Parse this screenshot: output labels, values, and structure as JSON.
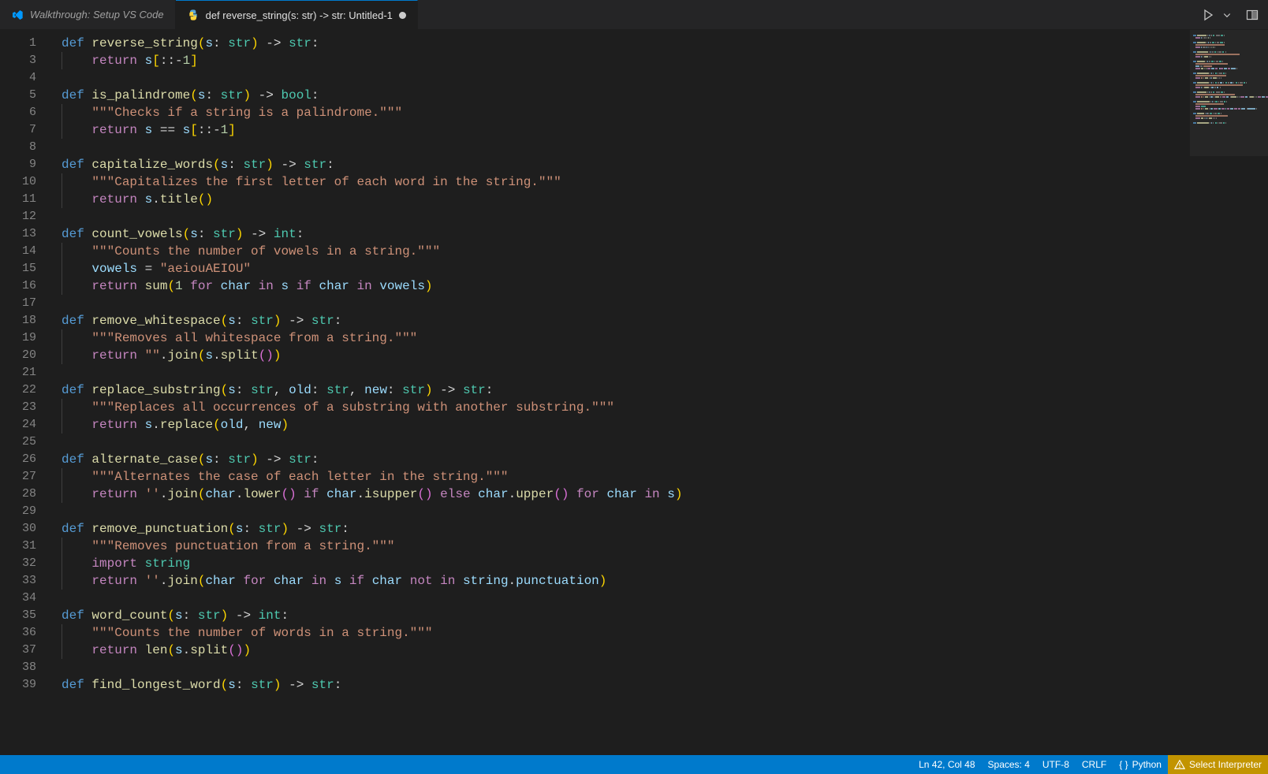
{
  "tabs": [
    {
      "icon": "vscode",
      "label": "Walkthrough: Setup VS Code",
      "active": false,
      "dirty": false
    },
    {
      "icon": "python",
      "label": "def reverse_string(s: str) -> str: Untitled-1",
      "active": true,
      "dirty": true
    }
  ],
  "actions": {
    "run": "run",
    "chevron": "chevron-down",
    "split": "split-horizontal",
    "more": "more"
  },
  "line_numbers": [
    1,
    3,
    4,
    5,
    6,
    7,
    8,
    9,
    10,
    11,
    12,
    13,
    14,
    15,
    16,
    17,
    18,
    19,
    20,
    21,
    22,
    23,
    24,
    25,
    26,
    27,
    28,
    29,
    30,
    31,
    32,
    33,
    34,
    35,
    36,
    37,
    38,
    39
  ],
  "code": [
    [
      {
        "t": "def ",
        "c": "kw"
      },
      {
        "t": "reverse_string",
        "c": "fn"
      },
      {
        "t": "(",
        "c": "brk1"
      },
      {
        "t": "s",
        "c": "prm"
      },
      {
        "t": ": ",
        "c": "pun"
      },
      {
        "t": "str",
        "c": "cls"
      },
      {
        "t": ")",
        "c": "brk1"
      },
      {
        "t": " -> ",
        "c": "op"
      },
      {
        "t": "str",
        "c": "cls"
      },
      {
        "t": ":",
        "c": "pun"
      }
    ],
    [
      {
        "indent": 1
      },
      {
        "t": "return ",
        "c": "kw2"
      },
      {
        "t": "s",
        "c": "prm"
      },
      {
        "t": "[",
        "c": "brk1"
      },
      {
        "t": "::",
        "c": "pun"
      },
      {
        "t": "-",
        "c": "op"
      },
      {
        "t": "1",
        "c": "num"
      },
      {
        "t": "]",
        "c": "brk1"
      }
    ],
    [],
    [
      {
        "t": "def ",
        "c": "kw"
      },
      {
        "t": "is_palindrome",
        "c": "fn"
      },
      {
        "t": "(",
        "c": "brk1"
      },
      {
        "t": "s",
        "c": "prm"
      },
      {
        "t": ": ",
        "c": "pun"
      },
      {
        "t": "str",
        "c": "cls"
      },
      {
        "t": ")",
        "c": "brk1"
      },
      {
        "t": " -> ",
        "c": "op"
      },
      {
        "t": "bool",
        "c": "cls"
      },
      {
        "t": ":",
        "c": "pun"
      }
    ],
    [
      {
        "indent": 1
      },
      {
        "t": "\"\"\"Checks if a string is a palindrome.\"\"\"",
        "c": "str"
      }
    ],
    [
      {
        "indent": 1
      },
      {
        "t": "return ",
        "c": "kw2"
      },
      {
        "t": "s",
        "c": "prm"
      },
      {
        "t": " == ",
        "c": "op"
      },
      {
        "t": "s",
        "c": "prm"
      },
      {
        "t": "[",
        "c": "brk1"
      },
      {
        "t": "::",
        "c": "pun"
      },
      {
        "t": "-",
        "c": "op"
      },
      {
        "t": "1",
        "c": "num"
      },
      {
        "t": "]",
        "c": "brk1"
      }
    ],
    [],
    [
      {
        "t": "def ",
        "c": "kw"
      },
      {
        "t": "capitalize_words",
        "c": "fn"
      },
      {
        "t": "(",
        "c": "brk1"
      },
      {
        "t": "s",
        "c": "prm"
      },
      {
        "t": ": ",
        "c": "pun"
      },
      {
        "t": "str",
        "c": "cls"
      },
      {
        "t": ")",
        "c": "brk1"
      },
      {
        "t": " -> ",
        "c": "op"
      },
      {
        "t": "str",
        "c": "cls"
      },
      {
        "t": ":",
        "c": "pun"
      }
    ],
    [
      {
        "indent": 1
      },
      {
        "t": "\"\"\"Capitalizes the first letter of each word in the string.\"\"\"",
        "c": "str"
      }
    ],
    [
      {
        "indent": 1
      },
      {
        "t": "return ",
        "c": "kw2"
      },
      {
        "t": "s",
        "c": "prm"
      },
      {
        "t": ".",
        "c": "pun"
      },
      {
        "t": "title",
        "c": "fn"
      },
      {
        "t": "(",
        "c": "brk1"
      },
      {
        "t": ")",
        "c": "brk1"
      }
    ],
    [],
    [
      {
        "t": "def ",
        "c": "kw"
      },
      {
        "t": "count_vowels",
        "c": "fn"
      },
      {
        "t": "(",
        "c": "brk1"
      },
      {
        "t": "s",
        "c": "prm"
      },
      {
        "t": ": ",
        "c": "pun"
      },
      {
        "t": "str",
        "c": "cls"
      },
      {
        "t": ")",
        "c": "brk1"
      },
      {
        "t": " -> ",
        "c": "op"
      },
      {
        "t": "int",
        "c": "cls"
      },
      {
        "t": ":",
        "c": "pun"
      }
    ],
    [
      {
        "indent": 1
      },
      {
        "t": "\"\"\"Counts the number of vowels in a string.\"\"\"",
        "c": "str"
      }
    ],
    [
      {
        "indent": 1
      },
      {
        "t": "vowels",
        "c": "prm"
      },
      {
        "t": " = ",
        "c": "op"
      },
      {
        "t": "\"aeiouAEIOU\"",
        "c": "str"
      }
    ],
    [
      {
        "indent": 1
      },
      {
        "t": "return ",
        "c": "kw2"
      },
      {
        "t": "sum",
        "c": "fn"
      },
      {
        "t": "(",
        "c": "brk1"
      },
      {
        "t": "1",
        "c": "num"
      },
      {
        "t": " for ",
        "c": "kw2"
      },
      {
        "t": "char",
        "c": "prm"
      },
      {
        "t": " in ",
        "c": "kw2"
      },
      {
        "t": "s",
        "c": "prm"
      },
      {
        "t": " if ",
        "c": "kw2"
      },
      {
        "t": "char",
        "c": "prm"
      },
      {
        "t": " in ",
        "c": "kw2"
      },
      {
        "t": "vowels",
        "c": "prm"
      },
      {
        "t": ")",
        "c": "brk1"
      }
    ],
    [],
    [
      {
        "t": "def ",
        "c": "kw"
      },
      {
        "t": "remove_whitespace",
        "c": "fn"
      },
      {
        "t": "(",
        "c": "brk1"
      },
      {
        "t": "s",
        "c": "prm"
      },
      {
        "t": ": ",
        "c": "pun"
      },
      {
        "t": "str",
        "c": "cls"
      },
      {
        "t": ")",
        "c": "brk1"
      },
      {
        "t": " -> ",
        "c": "op"
      },
      {
        "t": "str",
        "c": "cls"
      },
      {
        "t": ":",
        "c": "pun"
      }
    ],
    [
      {
        "indent": 1
      },
      {
        "t": "\"\"\"Removes all whitespace from a string.\"\"\"",
        "c": "str"
      }
    ],
    [
      {
        "indent": 1
      },
      {
        "t": "return ",
        "c": "kw2"
      },
      {
        "t": "\"\"",
        "c": "str"
      },
      {
        "t": ".",
        "c": "pun"
      },
      {
        "t": "join",
        "c": "fn"
      },
      {
        "t": "(",
        "c": "brk1"
      },
      {
        "t": "s",
        "c": "prm"
      },
      {
        "t": ".",
        "c": "pun"
      },
      {
        "t": "split",
        "c": "fn"
      },
      {
        "t": "(",
        "c": "brk2"
      },
      {
        "t": ")",
        "c": "brk2"
      },
      {
        "t": ")",
        "c": "brk1"
      }
    ],
    [],
    [
      {
        "t": "def ",
        "c": "kw"
      },
      {
        "t": "replace_substring",
        "c": "fn"
      },
      {
        "t": "(",
        "c": "brk1"
      },
      {
        "t": "s",
        "c": "prm"
      },
      {
        "t": ": ",
        "c": "pun"
      },
      {
        "t": "str",
        "c": "cls"
      },
      {
        "t": ", ",
        "c": "pun"
      },
      {
        "t": "old",
        "c": "prm"
      },
      {
        "t": ": ",
        "c": "pun"
      },
      {
        "t": "str",
        "c": "cls"
      },
      {
        "t": ", ",
        "c": "pun"
      },
      {
        "t": "new",
        "c": "prm"
      },
      {
        "t": ": ",
        "c": "pun"
      },
      {
        "t": "str",
        "c": "cls"
      },
      {
        "t": ")",
        "c": "brk1"
      },
      {
        "t": " -> ",
        "c": "op"
      },
      {
        "t": "str",
        "c": "cls"
      },
      {
        "t": ":",
        "c": "pun"
      }
    ],
    [
      {
        "indent": 1
      },
      {
        "t": "\"\"\"Replaces all occurrences of a substring with another substring.\"\"\"",
        "c": "str"
      }
    ],
    [
      {
        "indent": 1
      },
      {
        "t": "return ",
        "c": "kw2"
      },
      {
        "t": "s",
        "c": "prm"
      },
      {
        "t": ".",
        "c": "pun"
      },
      {
        "t": "replace",
        "c": "fn"
      },
      {
        "t": "(",
        "c": "brk1"
      },
      {
        "t": "old",
        "c": "prm"
      },
      {
        "t": ", ",
        "c": "pun"
      },
      {
        "t": "new",
        "c": "prm"
      },
      {
        "t": ")",
        "c": "brk1"
      }
    ],
    [],
    [
      {
        "t": "def ",
        "c": "kw"
      },
      {
        "t": "alternate_case",
        "c": "fn"
      },
      {
        "t": "(",
        "c": "brk1"
      },
      {
        "t": "s",
        "c": "prm"
      },
      {
        "t": ": ",
        "c": "pun"
      },
      {
        "t": "str",
        "c": "cls"
      },
      {
        "t": ")",
        "c": "brk1"
      },
      {
        "t": " -> ",
        "c": "op"
      },
      {
        "t": "str",
        "c": "cls"
      },
      {
        "t": ":",
        "c": "pun"
      }
    ],
    [
      {
        "indent": 1
      },
      {
        "t": "\"\"\"Alternates the case of each letter in the string.\"\"\"",
        "c": "str"
      }
    ],
    [
      {
        "indent": 1
      },
      {
        "t": "return ",
        "c": "kw2"
      },
      {
        "t": "''",
        "c": "str"
      },
      {
        "t": ".",
        "c": "pun"
      },
      {
        "t": "join",
        "c": "fn"
      },
      {
        "t": "(",
        "c": "brk1"
      },
      {
        "t": "char",
        "c": "prm"
      },
      {
        "t": ".",
        "c": "pun"
      },
      {
        "t": "lower",
        "c": "fn"
      },
      {
        "t": "(",
        "c": "brk2"
      },
      {
        "t": ")",
        "c": "brk2"
      },
      {
        "t": " if ",
        "c": "kw2"
      },
      {
        "t": "char",
        "c": "prm"
      },
      {
        "t": ".",
        "c": "pun"
      },
      {
        "t": "isupper",
        "c": "fn"
      },
      {
        "t": "(",
        "c": "brk2"
      },
      {
        "t": ")",
        "c": "brk2"
      },
      {
        "t": " else ",
        "c": "kw2"
      },
      {
        "t": "char",
        "c": "prm"
      },
      {
        "t": ".",
        "c": "pun"
      },
      {
        "t": "upper",
        "c": "fn"
      },
      {
        "t": "(",
        "c": "brk2"
      },
      {
        "t": ")",
        "c": "brk2"
      },
      {
        "t": " for ",
        "c": "kw2"
      },
      {
        "t": "char",
        "c": "prm"
      },
      {
        "t": " in ",
        "c": "kw2"
      },
      {
        "t": "s",
        "c": "prm"
      },
      {
        "t": ")",
        "c": "brk1"
      }
    ],
    [],
    [
      {
        "t": "def ",
        "c": "kw"
      },
      {
        "t": "remove_punctuation",
        "c": "fn"
      },
      {
        "t": "(",
        "c": "brk1"
      },
      {
        "t": "s",
        "c": "prm"
      },
      {
        "t": ": ",
        "c": "pun"
      },
      {
        "t": "str",
        "c": "cls"
      },
      {
        "t": ")",
        "c": "brk1"
      },
      {
        "t": " -> ",
        "c": "op"
      },
      {
        "t": "str",
        "c": "cls"
      },
      {
        "t": ":",
        "c": "pun"
      }
    ],
    [
      {
        "indent": 1
      },
      {
        "t": "\"\"\"Removes punctuation from a string.\"\"\"",
        "c": "str"
      }
    ],
    [
      {
        "indent": 1
      },
      {
        "t": "import ",
        "c": "kw2"
      },
      {
        "t": "string",
        "c": "cls"
      }
    ],
    [
      {
        "indent": 1
      },
      {
        "t": "return ",
        "c": "kw2"
      },
      {
        "t": "''",
        "c": "str"
      },
      {
        "t": ".",
        "c": "pun"
      },
      {
        "t": "join",
        "c": "fn"
      },
      {
        "t": "(",
        "c": "brk1"
      },
      {
        "t": "char",
        "c": "prm"
      },
      {
        "t": " for ",
        "c": "kw2"
      },
      {
        "t": "char",
        "c": "prm"
      },
      {
        "t": " in ",
        "c": "kw2"
      },
      {
        "t": "s",
        "c": "prm"
      },
      {
        "t": " if ",
        "c": "kw2"
      },
      {
        "t": "char",
        "c": "prm"
      },
      {
        "t": " not ",
        "c": "kw2"
      },
      {
        "t": "in ",
        "c": "kw2"
      },
      {
        "t": "string",
        "c": "prm"
      },
      {
        "t": ".",
        "c": "pun"
      },
      {
        "t": "punctuation",
        "c": "prm"
      },
      {
        "t": ")",
        "c": "brk1"
      }
    ],
    [],
    [
      {
        "t": "def ",
        "c": "kw"
      },
      {
        "t": "word_count",
        "c": "fn"
      },
      {
        "t": "(",
        "c": "brk1"
      },
      {
        "t": "s",
        "c": "prm"
      },
      {
        "t": ": ",
        "c": "pun"
      },
      {
        "t": "str",
        "c": "cls"
      },
      {
        "t": ")",
        "c": "brk1"
      },
      {
        "t": " -> ",
        "c": "op"
      },
      {
        "t": "int",
        "c": "cls"
      },
      {
        "t": ":",
        "c": "pun"
      }
    ],
    [
      {
        "indent": 1
      },
      {
        "t": "\"\"\"Counts the number of words in a string.\"\"\"",
        "c": "str"
      }
    ],
    [
      {
        "indent": 1
      },
      {
        "t": "return ",
        "c": "kw2"
      },
      {
        "t": "len",
        "c": "fn"
      },
      {
        "t": "(",
        "c": "brk1"
      },
      {
        "t": "s",
        "c": "prm"
      },
      {
        "t": ".",
        "c": "pun"
      },
      {
        "t": "split",
        "c": "fn"
      },
      {
        "t": "(",
        "c": "brk2"
      },
      {
        "t": ")",
        "c": "brk2"
      },
      {
        "t": ")",
        "c": "brk1"
      }
    ],
    [],
    [
      {
        "t": "def ",
        "c": "kw"
      },
      {
        "t": "find_longest_word",
        "c": "fn"
      },
      {
        "t": "(",
        "c": "brk1"
      },
      {
        "t": "s",
        "c": "prm"
      },
      {
        "t": ": ",
        "c": "pun"
      },
      {
        "t": "str",
        "c": "cls"
      },
      {
        "t": ")",
        "c": "brk1"
      },
      {
        "t": " -> ",
        "c": "op"
      },
      {
        "t": "str",
        "c": "cls"
      },
      {
        "t": ":",
        "c": "pun"
      }
    ]
  ],
  "status": {
    "cursor": "Ln 42, Col 48",
    "spaces": "Spaces: 4",
    "encoding": "UTF-8",
    "eol": "CRLF",
    "language_icon": "{ }",
    "language": "Python",
    "interpreter": "Select Interpreter"
  }
}
